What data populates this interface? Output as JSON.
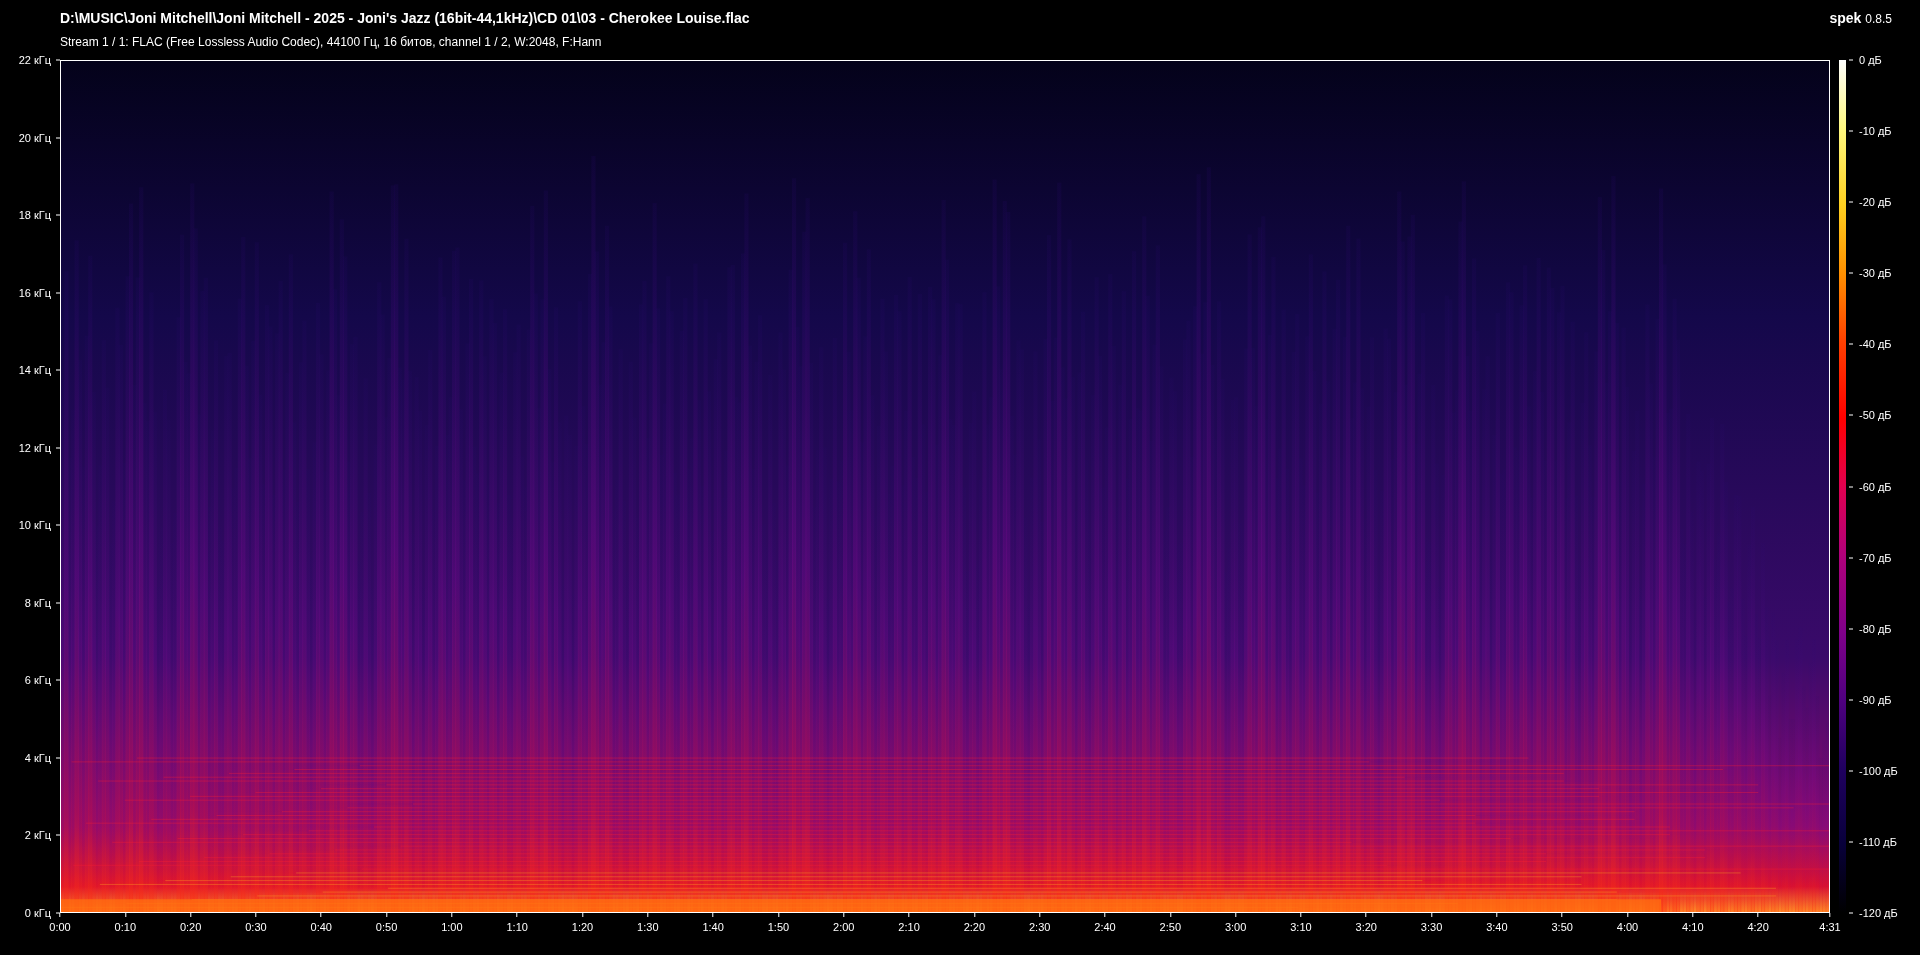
{
  "title": "D:\\MUSIC\\Joni Mitchell\\Joni Mitchell - 2025 - Joni's Jazz (16bit-44,1kHz)\\CD 01\\03 - Cherokee Louise.flac",
  "stream_info": "Stream 1 / 1: FLAC (Free Lossless Audio Codec), 44100 Гц, 16 битов, channel 1 / 2, W:2048, F:Hann",
  "app": {
    "name": "spek",
    "version": "0.8.5"
  },
  "frequency_axis": [
    "22 кГц",
    "20 кГц",
    "18 кГц",
    "16 кГц",
    "14 кГц",
    "12 кГц",
    "10 кГц",
    "8 кГц",
    "6 кГц",
    "4 кГц",
    "2 кГц",
    "0 кГц"
  ],
  "time_axis": [
    "0:00",
    "0:10",
    "0:20",
    "0:30",
    "0:40",
    "0:50",
    "1:00",
    "1:10",
    "1:20",
    "1:30",
    "1:40",
    "1:50",
    "2:00",
    "2:10",
    "2:20",
    "2:30",
    "2:40",
    "2:50",
    "3:00",
    "3:10",
    "3:20",
    "3:30",
    "3:40",
    "3:50",
    "4:00",
    "4:10",
    "4:20",
    "4:31"
  ],
  "db_scale": [
    "0 дБ",
    "-10 дБ",
    "-20 дБ",
    "-30 дБ",
    "-40 дБ",
    "-50 дБ",
    "-60 дБ",
    "-70 дБ",
    "-80 дБ",
    "-90 дБ",
    "-100 дБ",
    "-110 дБ",
    "-120 дБ"
  ]
}
